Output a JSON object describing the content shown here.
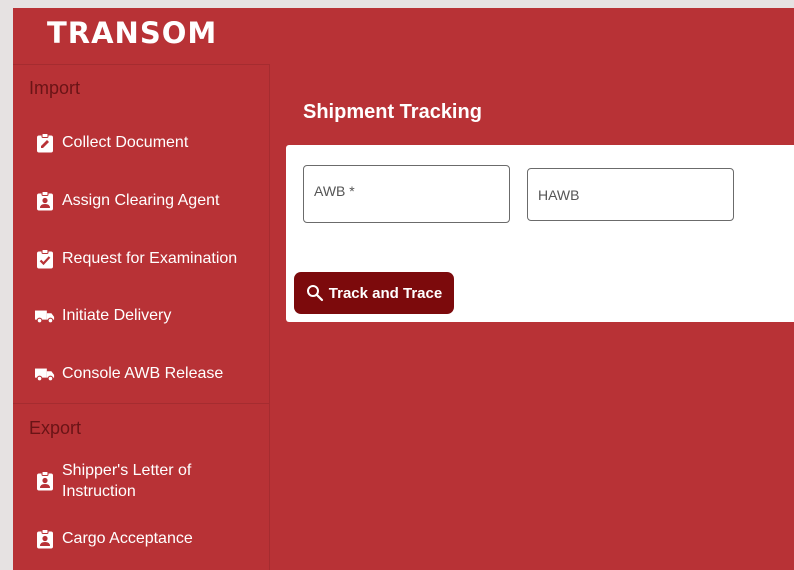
{
  "app": {
    "logo": "TRANSOM",
    "brand_color": "#b83236",
    "accent_dark": "#7c0a0c"
  },
  "sidebar": {
    "import": {
      "title": "Import",
      "items": [
        {
          "label": "Collect Document",
          "icon": "clipboard-edit-icon"
        },
        {
          "label": "Assign Clearing Agent",
          "icon": "clipboard-account-icon"
        },
        {
          "label": "Request for Examination",
          "icon": "clipboard-check-icon"
        },
        {
          "label": "Initiate Delivery",
          "icon": "truck-icon"
        },
        {
          "label": "Console AWB Release",
          "icon": "truck-icon"
        }
      ]
    },
    "export": {
      "title": "Export",
      "items": [
        {
          "label": "Shipper's Letter of",
          "label2": "Instruction",
          "icon": "clipboard-account-icon"
        },
        {
          "label": "Cargo Acceptance",
          "icon": "clipboard-account-icon"
        }
      ]
    }
  },
  "main": {
    "title": "Shipment Tracking",
    "awb_field": {
      "label": "AWB *",
      "value": ""
    },
    "hawb_field": {
      "label": "HAWB",
      "value": ""
    },
    "track_button": {
      "label": "Track and Trace",
      "icon": "search-icon"
    }
  }
}
